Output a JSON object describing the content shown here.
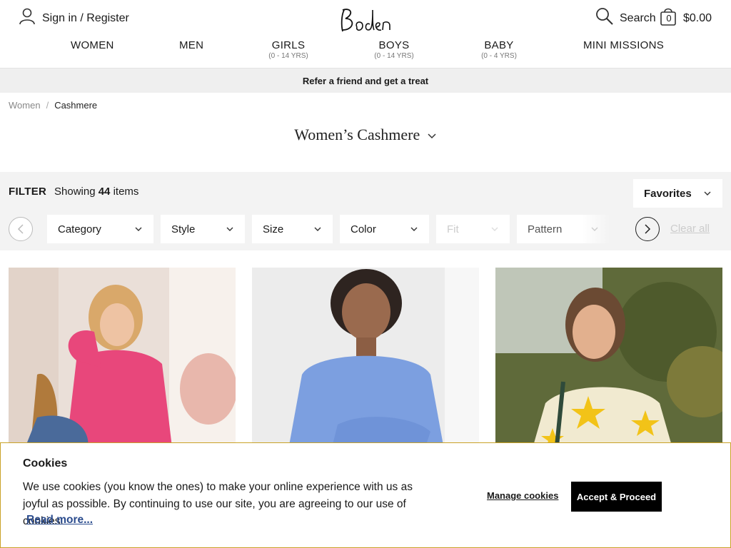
{
  "header": {
    "signin_label": "Sign in / Register",
    "search_label": "Search",
    "bag_count": "0",
    "bag_total": "$0.00"
  },
  "nav": [
    {
      "label": "WOMEN",
      "sub": ""
    },
    {
      "label": "MEN",
      "sub": ""
    },
    {
      "label": "GIRLS",
      "sub": "(0 - 14 YRS)"
    },
    {
      "label": "BOYS",
      "sub": "(0 - 14 YRS)"
    },
    {
      "label": "BABY",
      "sub": "(0 - 4 YRS)"
    },
    {
      "label": "MINI MISSIONS",
      "sub": ""
    }
  ],
  "promo": "Refer a friend and get a treat",
  "breadcrumb": {
    "parent": "Women",
    "separator": "/",
    "current": "Cashmere"
  },
  "page_title": "Women’s Cashmere",
  "filter": {
    "label": "FILTER",
    "showing_prefix": "Showing",
    "count": "44",
    "showing_suffix": "items",
    "sort_label": "Favorites",
    "dropdowns": [
      "Category",
      "Style",
      "Size",
      "Color",
      "Fit",
      "Pattern"
    ],
    "clear_all": "Clear all"
  },
  "products": [
    {
      "alt": "Pink cashmere cardigan",
      "colors": {
        "bg": "#e9dcd4",
        "top": "#e8477b"
      }
    },
    {
      "alt": "Blue cashmere jumper",
      "colors": {
        "bg": "#ececec",
        "top": "#7c9fe0"
      }
    },
    {
      "alt": "Cream star cashmere jumper",
      "colors": {
        "bg": "#6a6b3a",
        "top": "#f1ead0"
      }
    }
  ],
  "cookie": {
    "title": "Cookies",
    "text": "We use cookies (you know the ones) to make your online experience with us as joyful as possible. By continuing to use our site, you are agreeing to our use of cookies.",
    "read_more": "Read more...",
    "manage": "Manage cookies",
    "accept": "Accept & Proceed"
  },
  "colors": {
    "accent": "#c9a227",
    "link": "#2a4b8d"
  }
}
